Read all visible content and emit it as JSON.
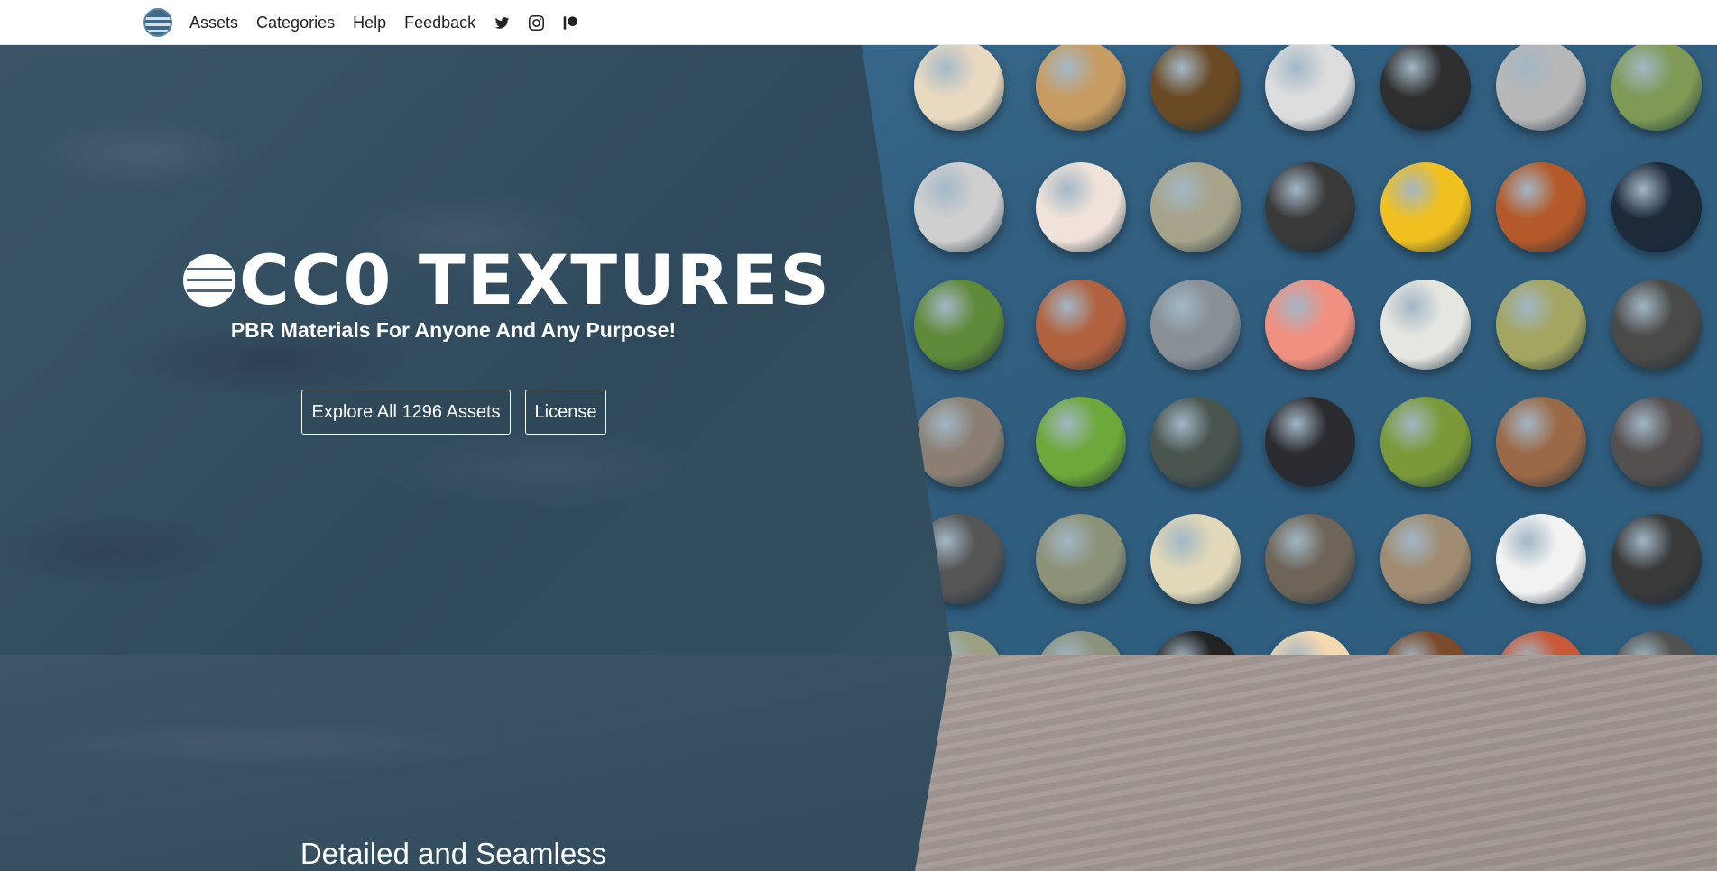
{
  "nav": {
    "links": [
      "Assets",
      "Categories",
      "Help",
      "Feedback"
    ],
    "icons": [
      "twitter-icon",
      "instagram-icon",
      "patreon-icon"
    ]
  },
  "hero": {
    "title": "CC0 TEXTURES",
    "tagline": "PBR Materials For Anyone And Any Purpose!",
    "explore_button": "Explore All 1296 Assets",
    "license_button": "License"
  },
  "section": {
    "heading": "Detailed and Seamless"
  },
  "colors": {
    "nav_bg": "#ffffff",
    "hero_overlay": "#2e4555",
    "sphere_panel": "#325f80",
    "text": "#ffffff"
  }
}
